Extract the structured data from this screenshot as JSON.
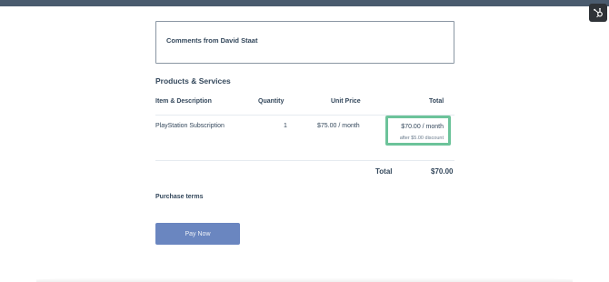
{
  "comments": {
    "title": "Comments from David Staat"
  },
  "products": {
    "section_title": "Products & Services",
    "columns": {
      "item": "Item & Description",
      "quantity": "Quantity",
      "unit_price": "Unit Price",
      "total": "Total"
    },
    "rows": [
      {
        "item": "PlayStation Subscription",
        "quantity": "1",
        "unit_price": "$75.00 / month",
        "total": "$70.00 / month",
        "discount_note": "after $5.00 discount"
      }
    ],
    "grand_total_label": "Total",
    "grand_total_value": "$70.00"
  },
  "purchase_terms": {
    "label": "Purchase terms"
  },
  "pay_button": {
    "label": "Pay Now"
  },
  "colors": {
    "top_bar": "#4a5b6e",
    "highlight_border": "#6cc39a",
    "pay_button_bg": "#6a86c0",
    "text": "#33475b"
  },
  "icons": {
    "corner": "hubspot-logo-icon"
  }
}
